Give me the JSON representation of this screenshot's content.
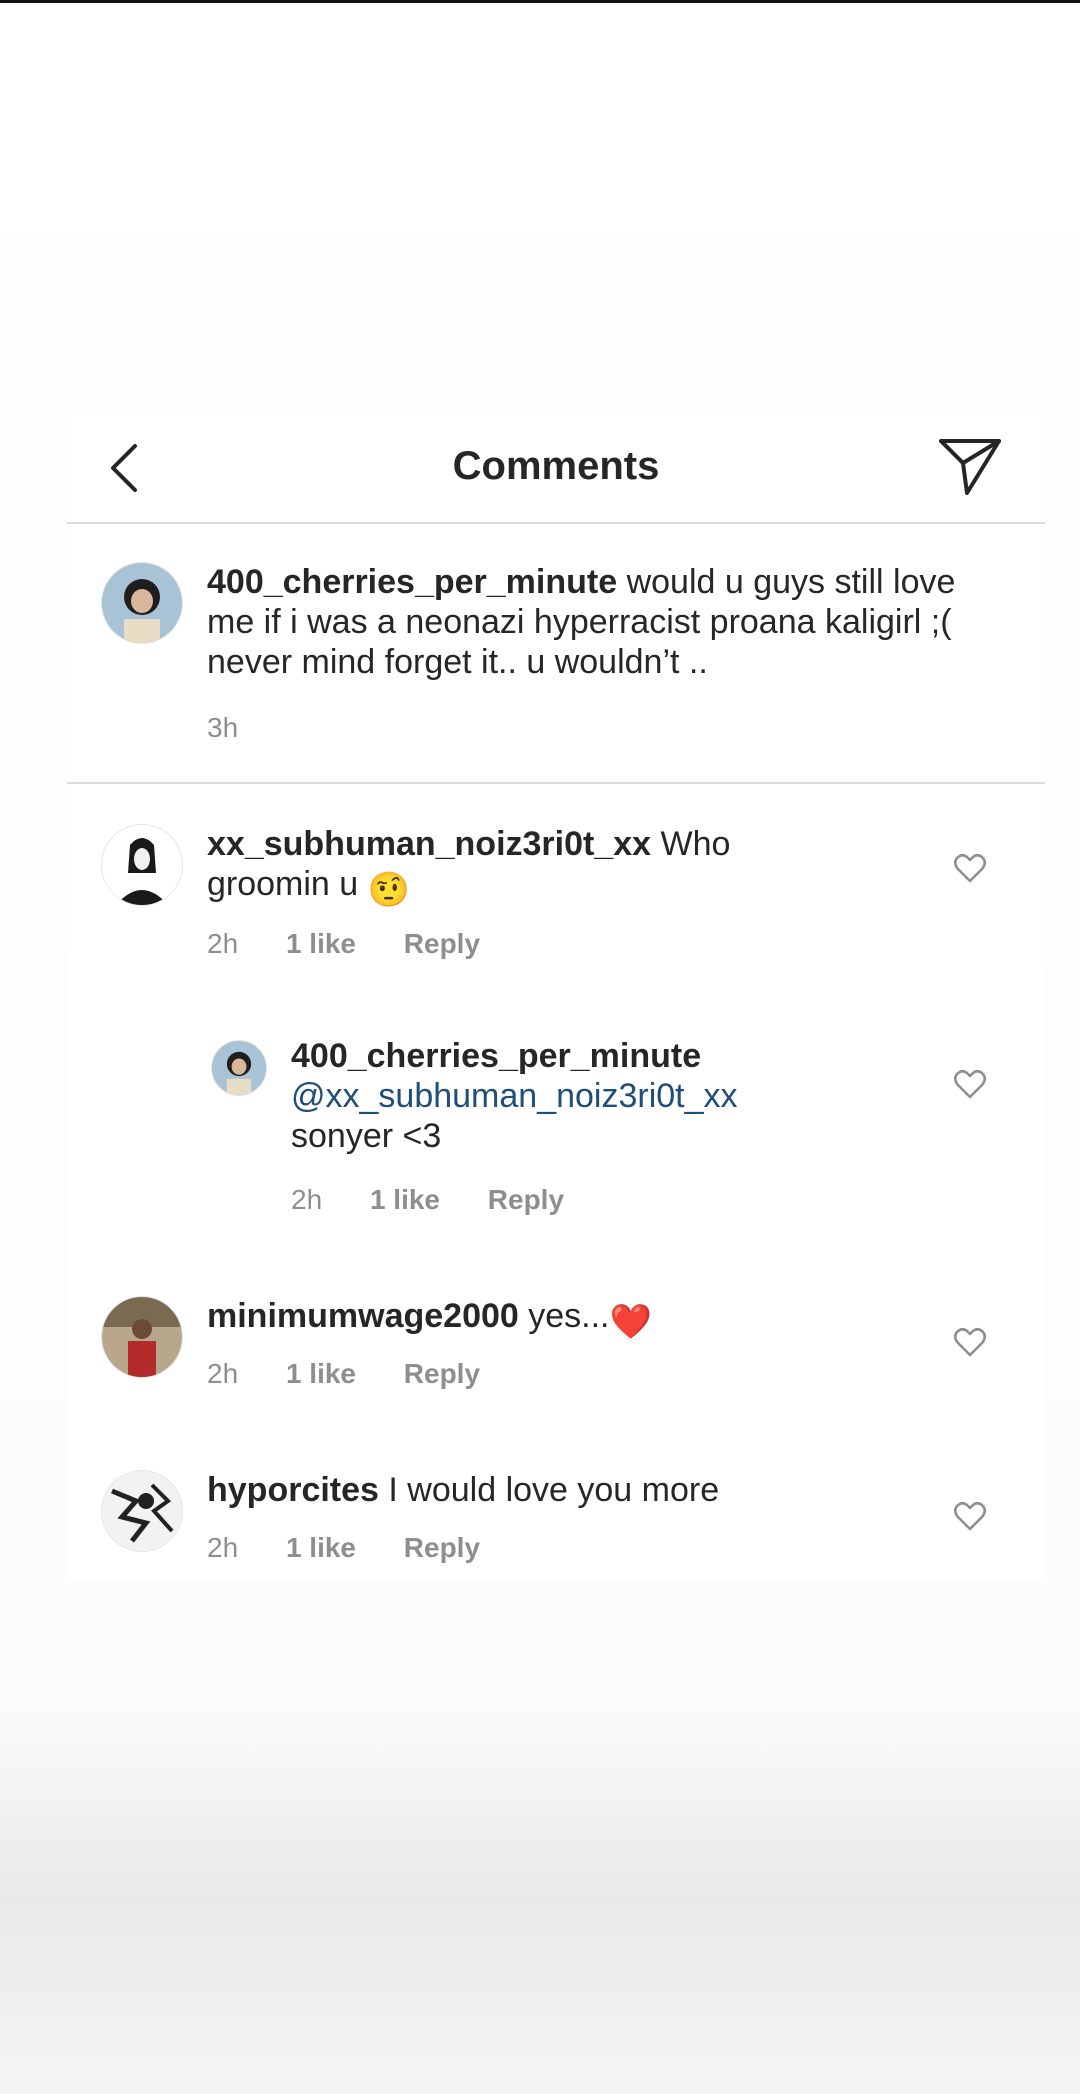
{
  "header": {
    "title": "Comments",
    "back_icon": "chevron-left-icon",
    "send_icon": "paper-plane-icon"
  },
  "caption": {
    "username": "400_cherries_per_minute",
    "text": "would u guys still love me if i was a neonazi hyperracist proana kaligirl ;( never mind forget it.. u wouldn’t ..",
    "time": "3h"
  },
  "comments": [
    {
      "username": "xx_subhuman_noiz3ri0t_xx",
      "text": "Who groomin u",
      "emoji": "🤨",
      "time": "2h",
      "likes": "1 like",
      "reply": "Reply"
    },
    {
      "username": "400_cherries_per_minute",
      "mention": "@xx_subhuman_noiz3ri0t_xx",
      "text": "sonyer <3",
      "time": "2h",
      "likes": "1 like",
      "reply": "Reply"
    },
    {
      "username": "minimumwage2000",
      "text": "yes...",
      "emoji": "❤️",
      "time": "2h",
      "likes": "1 like",
      "reply": "Reply"
    },
    {
      "username": "hyporcites",
      "text": "I would love you more",
      "time": "2h",
      "likes": "1 like",
      "reply": "Reply"
    }
  ],
  "colors": {
    "text": "#262626",
    "meta": "#8e8e8e",
    "mention": "#1f4e7a",
    "divider": "#dbdbdb"
  }
}
